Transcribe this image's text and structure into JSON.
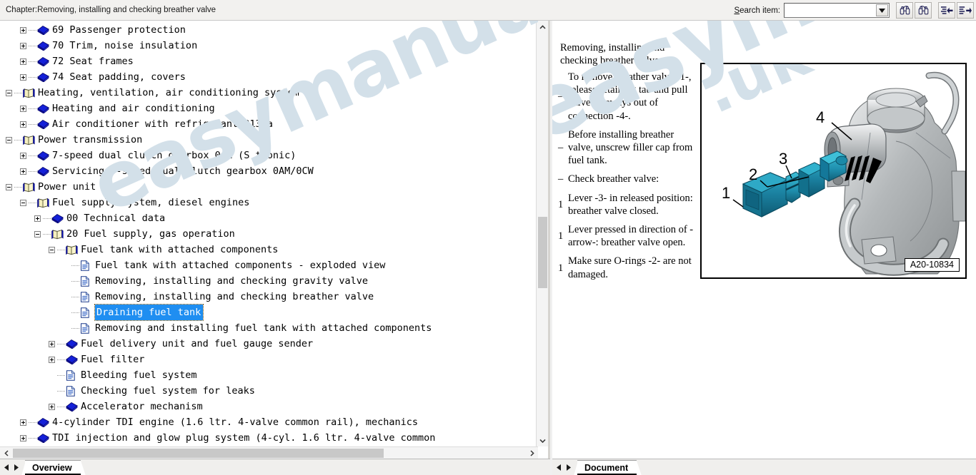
{
  "window": {
    "chapter_title": "Chapter:Removing, installing and checking breather valve"
  },
  "toolbar": {
    "search_label": "Search item:",
    "search_value": "",
    "search_placeholder": "",
    "dropdown_arrow": "chevron-down-icon",
    "buttons": [
      {
        "name": "find-previous-button",
        "icon": "binoculars-up-icon",
        "title": "Find previous"
      },
      {
        "name": "find-next-button",
        "icon": "binoculars-down-icon",
        "title": "Find next"
      },
      {
        "name": "collapse-list-button",
        "icon": "list-arrow-left-icon",
        "title": "Previous item"
      },
      {
        "name": "expand-list-button",
        "icon": "list-arrow-right-icon",
        "title": "Next item"
      }
    ]
  },
  "watermark": {
    "text": "easymanuals.co.uk",
    "color": "#d3e0e9"
  },
  "tree": {
    "selected_index": 18,
    "selection_color": "#1f8ef1",
    "items": [
      {
        "label": "69 Passenger protection",
        "depth": 1,
        "toggle": "plus",
        "icon": "book-closed-icon"
      },
      {
        "label": "70 Trim, noise insulation",
        "depth": 1,
        "toggle": "plus",
        "icon": "book-closed-icon"
      },
      {
        "label": "72 Seat frames",
        "depth": 1,
        "toggle": "plus",
        "icon": "book-closed-icon"
      },
      {
        "label": "74 Seat padding, covers",
        "depth": 1,
        "toggle": "plus",
        "icon": "book-closed-icon"
      },
      {
        "label": "Heating, ventilation, air conditioning system",
        "depth": 0,
        "toggle": "minus",
        "icon": "book-open-icon"
      },
      {
        "label": "Heating and air conditioning",
        "depth": 1,
        "toggle": "plus",
        "icon": "book-closed-icon"
      },
      {
        "label": "Air conditioner with refrigerant R134a",
        "depth": 1,
        "toggle": "plus",
        "icon": "book-closed-icon"
      },
      {
        "label": "Power transmission",
        "depth": 0,
        "toggle": "minus",
        "icon": "book-open-icon"
      },
      {
        "label": "7-speed dual clutch gearbox 0AM (S tronic)",
        "depth": 1,
        "toggle": "plus",
        "icon": "book-closed-icon"
      },
      {
        "label": "Servicing 7-speed dual clutch gearbox 0AM/0CW",
        "depth": 1,
        "toggle": "plus",
        "icon": "book-closed-icon"
      },
      {
        "label": "Power unit",
        "depth": 0,
        "toggle": "minus",
        "icon": "book-open-icon"
      },
      {
        "label": "Fuel supply system, diesel engines",
        "depth": 1,
        "toggle": "minus",
        "icon": "book-open-icon"
      },
      {
        "label": "00 Technical data",
        "depth": 2,
        "toggle": "plus",
        "icon": "book-closed-icon"
      },
      {
        "label": "20 Fuel supply, gas operation",
        "depth": 2,
        "toggle": "minus",
        "icon": "book-open-icon"
      },
      {
        "label": "Fuel tank with attached components",
        "depth": 3,
        "toggle": "minus",
        "icon": "book-open-icon"
      },
      {
        "label": "Fuel tank with attached components - exploded view",
        "depth": 4,
        "toggle": "leaf",
        "icon": "document-icon"
      },
      {
        "label": "Removing, installing and checking gravity valve",
        "depth": 4,
        "toggle": "leaf",
        "icon": "document-icon"
      },
      {
        "label": "Removing, installing and checking breather valve",
        "depth": 4,
        "toggle": "leaf",
        "icon": "document-icon"
      },
      {
        "label": "Draining fuel tank",
        "depth": 4,
        "toggle": "leaf",
        "icon": "document-icon"
      },
      {
        "label": "Removing and installing fuel tank with attached components",
        "depth": 4,
        "toggle": "leaf",
        "icon": "document-icon"
      },
      {
        "label": "Fuel delivery unit and fuel gauge sender",
        "depth": 3,
        "toggle": "plus",
        "icon": "book-closed-icon"
      },
      {
        "label": "Fuel filter",
        "depth": 3,
        "toggle": "plus",
        "icon": "book-closed-icon"
      },
      {
        "label": "Bleeding fuel system",
        "depth": 3,
        "toggle": "leaf",
        "icon": "document-icon"
      },
      {
        "label": "Checking fuel system for leaks",
        "depth": 3,
        "toggle": "leaf",
        "icon": "document-icon"
      },
      {
        "label": "Accelerator mechanism",
        "depth": 3,
        "toggle": "plus",
        "icon": "book-closed-icon"
      },
      {
        "label": "4-cylinder TDI engine (1.6 ltr. 4-valve common rail), mechanics",
        "depth": 1,
        "toggle": "plus",
        "icon": "book-closed-icon"
      },
      {
        "label": "TDI injection and glow plug system (4-cyl. 1.6 ltr. 4-valve common",
        "depth": 1,
        "toggle": "plus",
        "icon": "book-closed-icon"
      }
    ]
  },
  "document": {
    "heading": "Removing, installing and checking breather valve",
    "bullets": [
      {
        "mark": "–",
        "text": "To remove breather valve -1-, release retaining tab and pull valve sideways out of connection -4-."
      },
      {
        "mark": "–",
        "text": "Before installing breather valve, unscrew filler cap from fuel tank."
      },
      {
        "mark": "–",
        "text": "Check breather valve:"
      },
      {
        "mark": "1",
        "text": "Lever -3- in released position: breather valve closed."
      },
      {
        "mark": "1",
        "text": "Lever pressed in direction of -arrow-: breather valve open."
      },
      {
        "mark": "1",
        "text": "Make sure O-rings -2- are not damaged."
      }
    ],
    "figure": {
      "id_label": "A20-10834",
      "callouts": [
        "1",
        "2",
        "3",
        "4"
      ],
      "valve_color": "#1a7f9e",
      "body_color": "#b9bcbe"
    }
  },
  "statusbars": {
    "left": {
      "tab_label": "Overview",
      "nav_prev": "nav-left-icon",
      "nav_next": "nav-right-icon"
    },
    "right": {
      "tab_label": "Document",
      "nav_prev": "nav-left-icon",
      "nav_next": "nav-right-icon"
    }
  },
  "scrollbars": {
    "left_vertical": {
      "up": "scroll-up-icon",
      "down": "scroll-down-icon"
    },
    "left_horizontal": {
      "left": "scroll-left-icon",
      "right": "scroll-right-icon"
    }
  }
}
